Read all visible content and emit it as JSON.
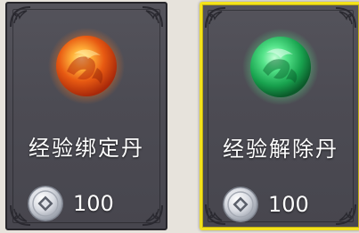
{
  "items": [
    {
      "name": "经验绑定丹",
      "price": "100",
      "orb_color": "#ef6a1a",
      "selected": false,
      "icon": "fire-orb-icon"
    },
    {
      "name": "经验解除丹",
      "price": "100",
      "orb_color": "#2fd06d",
      "selected": true,
      "icon": "jade-orb-icon"
    }
  ],
  "currency_icon": "silver-coin-icon",
  "colors": {
    "selected_border": "#f3e21d",
    "card_background": "#4c4b53",
    "page_background": "#e7e3dc"
  }
}
